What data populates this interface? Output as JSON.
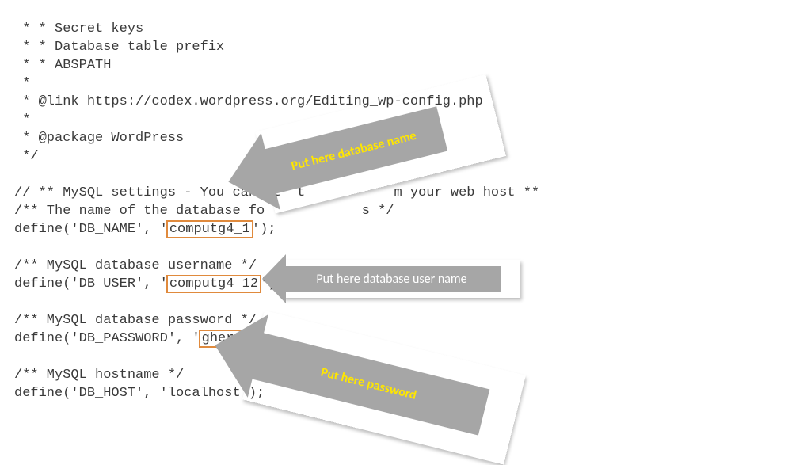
{
  "code": {
    "l1": " * * Secret keys",
    "l2": " * * Database table prefix",
    "l3": " * * ABSPATH",
    "l4": " *",
    "l5": " * @link https://codex.wordpress.org/Editing_wp-config.php",
    "l6": " *",
    "l7": " * @package WordPress",
    "l8": " */",
    "l9": "",
    "l10a": "// ** MySQL settings - You can g",
    "l10b": "t  t",
    "l10c": "m your web host ** ",
    "l11a": "/** The name of the database fo",
    "l11b": "s */",
    "l12a": "define('DB_NAME', '",
    "l12v": "computg4_1",
    "l12b": "');",
    "l13": "",
    "l14": "/** MySQL database username */",
    "l15a": "define('DB_USER', '",
    "l15v": "computg4_12",
    "l15b": "');",
    "l16": "",
    "l17": "/** MySQL database password */",
    "l18a": "define('DB_PASSWORD', '",
    "l18v": "ghert",
    "l18b": "');",
    "l19": "",
    "l20": "/** MySQL hostname */",
    "l21": "define('DB_HOST', 'localhost');"
  },
  "annotations": {
    "arrow1": "Put here database name",
    "arrow2": "Put here database user name",
    "arrow3": "Put here password"
  },
  "colors": {
    "arrow_fill": "#a6a6a6",
    "highlight_border": "#e08a3d",
    "text_yellow": "#ffe600",
    "text_white": "#ffffff"
  }
}
